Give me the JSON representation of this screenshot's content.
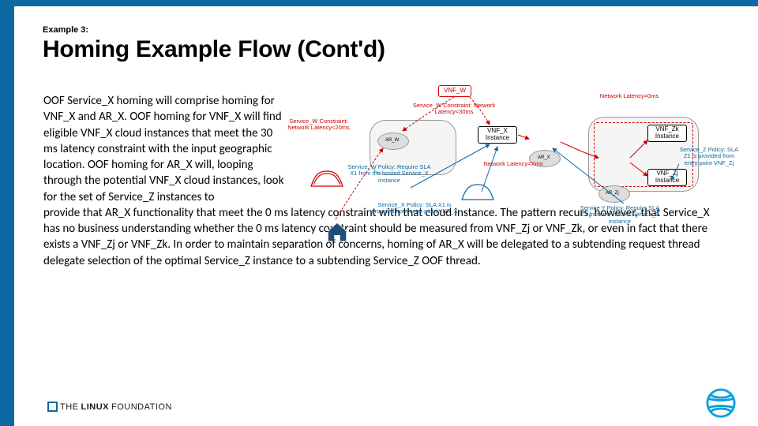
{
  "kicker": "Example 3:",
  "title": "Homing Example Flow (Cont'd)",
  "body_prefix": "OOF Service_X homing will comprise homing for VNF_X and AR_X. OOF homing for VNF_X will find eligible VNF_X cloud instances that meet the 30 ms latency constraint with the input geographic location.  OOF homing for AR_X will, looping through the potential VNF_X cloud instances, look for the set of Service_Z  instances to",
  "body_full": "provide that AR_X functionality that meet the 0 ms latency constraint with that cloud instance.  The pattern recurs, however, that Service_X has no business understanding whether the 0 ms latency constraint should be measured from VNF_Zj or VNF_Zk, or even in fact that there exists a VNF_Zj or VNF_Zk.  In order to maintain separation of concerns, homing of AR_X will be delegated to a subtending  request thread delegate selection of the optimal Service_Z instance to a subtending Service_Z OOF thread.",
  "diagram": {
    "vnf_w": "VNF_W",
    "vnf_x": "VNF_X Instance",
    "vnf_zk": "VNF_Zk Instance",
    "vnf_zj": "VNF_Zj Instance",
    "ar_w": "AR_W",
    "ar_x": "AR_X",
    "ar_zj": "AR_Zj",
    "service_w_constraint_l": "Service_W Constraint: Network Latency<20ms",
    "service_w_constraint_r": "Service_W Constraint: Network Latency<30ms",
    "latency_xm": "Network Latency=Xms",
    "latency_0ms": "Network Latency=0ms",
    "service_w_policy": "Service_W Policy: Require SLA X1 from the hosted Service_X instance",
    "service_x_policy": "Service_X Policy: SLA X1 is provided from entry point VNF_X",
    "service_y_policy": "Service Y Policy: Require SLA Z1 from the hosted Service_Z instance",
    "service_z_policy": "Service_Z Policy: SLA Z1 is provided from entry point VNF_Zj"
  },
  "footer": {
    "logo1": "THE",
    "logo2": "LINUX",
    "logo3": "FOUNDATION"
  }
}
